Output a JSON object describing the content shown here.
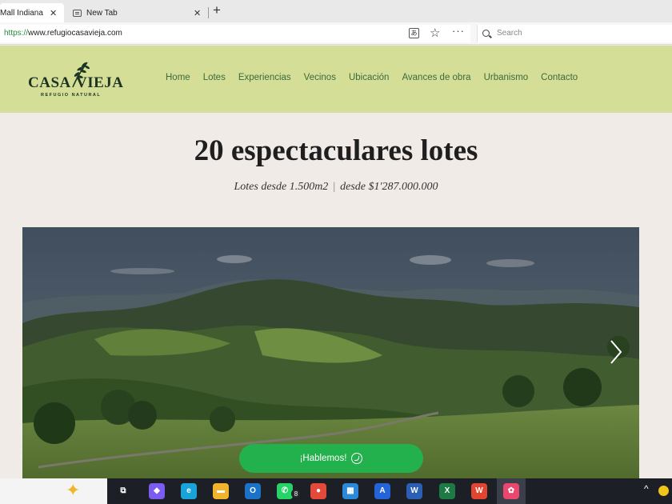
{
  "browser": {
    "tabs": [
      {
        "title": "Mall Indiana",
        "close": "✕"
      },
      {
        "title": "New Tab",
        "close": "✕"
      }
    ],
    "new_tab": "+",
    "url_scheme": "https://",
    "url_rest": "www.refugiocasavieja.com",
    "search_placeholder": "Search",
    "translate_glyph": "あ",
    "star_glyph": "☆",
    "more_glyph": "···"
  },
  "site": {
    "logo": {
      "left": "CASA",
      "right": "VIEJA",
      "tagline": "REFUGIO NATURAL"
    },
    "nav": [
      "Home",
      "Lotes",
      "Experiencias",
      "Vecinos",
      "Ubicación",
      "Avances de obra",
      "Urbanismo",
      "Contacto"
    ],
    "hero": {
      "title": "20 espectaculares lotes",
      "subtitle_left": "Lotes desde 1.500m2",
      "subtitle_sep": "|",
      "subtitle_right": "desde $1'287.000.000"
    },
    "cta": "¡Hablemos!",
    "colors": {
      "header_bg": "#d4de96",
      "nav_text": "#3c6b3c",
      "cta_bg": "#23b14d",
      "page_bg": "#f1ebe7"
    }
  },
  "taskbar": {
    "badge": "8",
    "chevron": "^",
    "apps": [
      {
        "name": "task-view",
        "glyph": "⧉",
        "color": "#1c1f26"
      },
      {
        "name": "copilot",
        "glyph": "◆",
        "color": "#7b5cf0"
      },
      {
        "name": "edge",
        "glyph": "e",
        "color": "#1aa3d9"
      },
      {
        "name": "file-explorer",
        "glyph": "▬",
        "color": "#f1b52b"
      },
      {
        "name": "outlook",
        "glyph": "O",
        "color": "#1a73c9"
      },
      {
        "name": "whatsapp",
        "glyph": "✆",
        "color": "#25d366"
      },
      {
        "name": "chrome",
        "glyph": "●",
        "color": "#e44a3a"
      },
      {
        "name": "store",
        "glyph": "▦",
        "color": "#2b89d9"
      },
      {
        "name": "azure",
        "glyph": "A",
        "color": "#2563d9"
      },
      {
        "name": "word",
        "glyph": "W",
        "color": "#2b5fb4"
      },
      {
        "name": "excel",
        "glyph": "X",
        "color": "#1e7a45"
      },
      {
        "name": "wps",
        "glyph": "W",
        "color": "#e2452f"
      },
      {
        "name": "picasa",
        "glyph": "✿",
        "color": "#e9476e"
      }
    ]
  }
}
